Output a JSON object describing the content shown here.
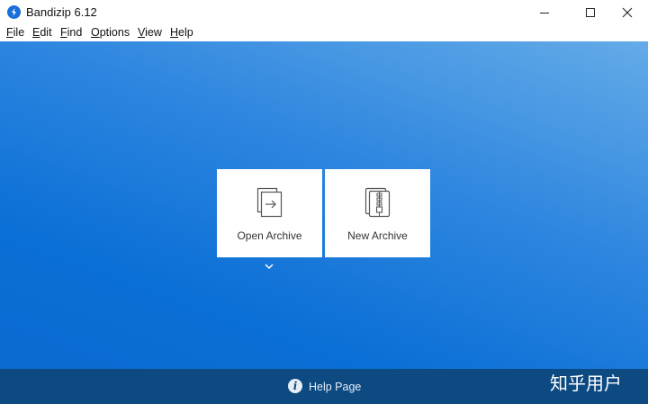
{
  "window": {
    "title": "Bandizip 6.12"
  },
  "menu": [
    {
      "label": "File",
      "mnemonic": "F",
      "rest": "ile"
    },
    {
      "label": "Edit",
      "mnemonic": "E",
      "rest": "dit"
    },
    {
      "label": "Find",
      "mnemonic": "F",
      "rest": "ind"
    },
    {
      "label": "Options",
      "mnemonic": "O",
      "rest": "ptions"
    },
    {
      "label": "View",
      "mnemonic": "V",
      "rest": "iew"
    },
    {
      "label": "Help",
      "mnemonic": "H",
      "rest": "elp"
    }
  ],
  "main": {
    "open_archive_label": "Open Archive",
    "new_archive_label": "New Archive"
  },
  "footer": {
    "help_label": "Help Page",
    "help_icon_glyph": "i",
    "watermark": "知乎用户"
  },
  "colors": {
    "accent": "#1a6fd8",
    "footer": "#0d4a82"
  },
  "icons": {
    "app": "bandizip-logo-icon",
    "open": "open-archive-icon",
    "new": "new-archive-zipper-icon",
    "help": "info-icon",
    "expand": "chevron-down-icon"
  }
}
